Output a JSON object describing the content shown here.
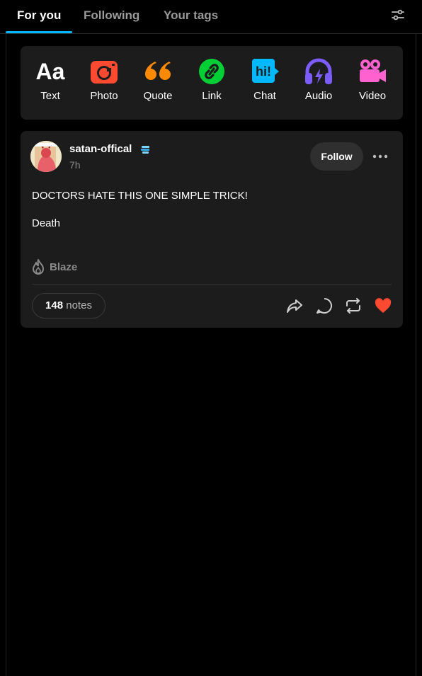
{
  "tabs": [
    {
      "label": "For you",
      "active": true
    },
    {
      "label": "Following",
      "active": false
    },
    {
      "label": "Your tags",
      "active": false
    }
  ],
  "composer": {
    "types": [
      {
        "label": "Text",
        "icon": "text-icon",
        "color": "#ffffff"
      },
      {
        "label": "Photo",
        "icon": "camera-icon",
        "color": "#ff4930"
      },
      {
        "label": "Quote",
        "icon": "quote-icon",
        "color": "#ff8a00"
      },
      {
        "label": "Link",
        "icon": "link-icon",
        "color": "#00cf35"
      },
      {
        "label": "Chat",
        "icon": "chat-icon",
        "color": "#00b8ff"
      },
      {
        "label": "Audio",
        "icon": "headphones-icon",
        "color": "#7c5cff"
      },
      {
        "label": "Video",
        "icon": "video-camera-icon",
        "color": "#ff62ce"
      }
    ],
    "text_glyph": "Aa",
    "chat_glyph": "hi!"
  },
  "post": {
    "username": "satan-offical",
    "time_ago": "7h",
    "follow_label": "Follow",
    "body": [
      "DOCTORS HATE THIS ONE SIMPLE TRICK!",
      "Death"
    ],
    "blaze_label": "Blaze",
    "notes_count": "148",
    "notes_word": "notes",
    "liked": true
  },
  "colors": {
    "accent": "#00b8ff",
    "like": "#ff4930",
    "card": "#1c1c1c"
  }
}
